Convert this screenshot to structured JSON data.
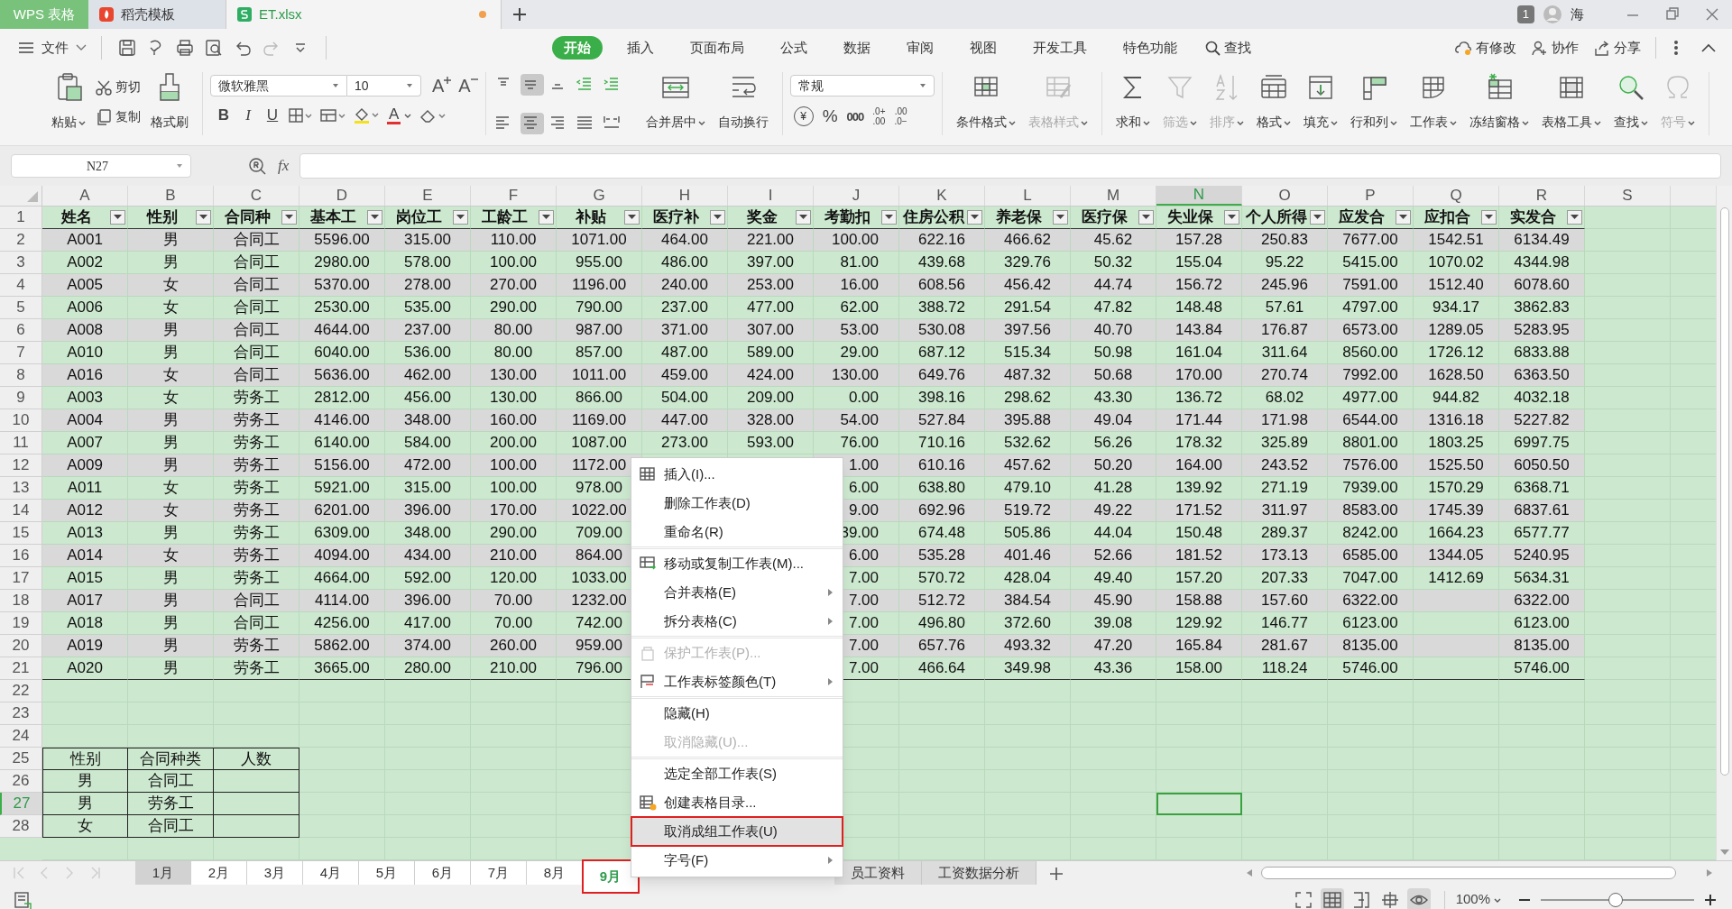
{
  "title_tabs": [
    {
      "label": "WPS 表格",
      "kind": "app",
      "selected": false,
      "unsaved": false
    },
    {
      "label": "稻壳模板",
      "kind": "template",
      "selected": false,
      "unsaved": false
    },
    {
      "label": "ET.xlsx",
      "kind": "file",
      "selected": true,
      "unsaved": true
    }
  ],
  "window": {
    "badge": "1",
    "user": "海"
  },
  "menu": {
    "file": "文件",
    "tabs": [
      {
        "label": "开始",
        "selected": true
      },
      {
        "label": "插入",
        "selected": false
      },
      {
        "label": "页面布局",
        "selected": false
      },
      {
        "label": "公式",
        "selected": false
      },
      {
        "label": "数据",
        "selected": false
      },
      {
        "label": "审阅",
        "selected": false
      },
      {
        "label": "视图",
        "selected": false
      },
      {
        "label": "开发工具",
        "selected": false
      },
      {
        "label": "特色功能",
        "selected": false
      }
    ],
    "search": "查找",
    "actions": [
      "有修改",
      "协作",
      "分享"
    ]
  },
  "ribbon": {
    "paste": "粘贴",
    "cut": "剪切",
    "copy": "复制",
    "format_painter": "格式刷",
    "font_name": "微软雅黑",
    "font_size": "10",
    "font_buttons": [
      "B",
      "I",
      "U"
    ],
    "font_grow": "A",
    "font_shrink": "A",
    "font_color": "A",
    "merge": "合并居中",
    "wrap": "自动换行",
    "number_format": "常规",
    "number_buttons": [
      "¥",
      "%",
      "000"
    ],
    "decimal_buttons": [
      {
        "top": ".0+",
        "bottom": ".00"
      },
      {
        "top": ".00",
        "bottom": ".0−"
      }
    ],
    "tools": [
      {
        "label": "条件格式",
        "disabled": false
      },
      {
        "label": "表格样式",
        "disabled": true
      },
      {
        "label": "求和",
        "disabled": false
      },
      {
        "label": "筛选",
        "disabled": true
      },
      {
        "label": "排序",
        "disabled": true
      },
      {
        "label": "格式",
        "disabled": false
      },
      {
        "label": "填充",
        "disabled": false
      },
      {
        "label": "行和列",
        "disabled": false
      },
      {
        "label": "工作表",
        "disabled": false
      },
      {
        "label": "冻结窗格",
        "disabled": false
      },
      {
        "label": "表格工具",
        "disabled": false
      },
      {
        "label": "查找",
        "disabled": false
      },
      {
        "label": "符号",
        "disabled": true
      }
    ]
  },
  "formula_bar": {
    "name_box": "N27",
    "fx": "fx"
  },
  "sheet": {
    "columns": [
      {
        "letter": "A",
        "selected": false
      },
      {
        "letter": "B",
        "selected": false
      },
      {
        "letter": "C",
        "selected": false
      },
      {
        "letter": "D",
        "selected": false
      },
      {
        "letter": "E",
        "selected": false
      },
      {
        "letter": "F",
        "selected": false
      },
      {
        "letter": "G",
        "selected": false
      },
      {
        "letter": "H",
        "selected": false
      },
      {
        "letter": "I",
        "selected": false
      },
      {
        "letter": "J",
        "selected": false
      },
      {
        "letter": "K",
        "selected": false
      },
      {
        "letter": "L",
        "selected": false
      },
      {
        "letter": "M",
        "selected": false
      },
      {
        "letter": "N",
        "selected": true
      },
      {
        "letter": "O",
        "selected": false
      },
      {
        "letter": "P",
        "selected": false
      },
      {
        "letter": "Q",
        "selected": false
      },
      {
        "letter": "R",
        "selected": false
      },
      {
        "letter": "S",
        "selected": false
      }
    ],
    "row_headers": [
      {
        "label": "1",
        "selected": false
      },
      {
        "label": "2",
        "selected": false
      },
      {
        "label": "3",
        "selected": false
      },
      {
        "label": "4",
        "selected": false
      },
      {
        "label": "5",
        "selected": false
      },
      {
        "label": "6",
        "selected": false
      },
      {
        "label": "7",
        "selected": false
      },
      {
        "label": "8",
        "selected": false
      },
      {
        "label": "9",
        "selected": false
      },
      {
        "label": "10",
        "selected": false
      },
      {
        "label": "11",
        "selected": false
      },
      {
        "label": "12",
        "selected": false
      },
      {
        "label": "13",
        "selected": false
      },
      {
        "label": "14",
        "selected": false
      },
      {
        "label": "15",
        "selected": false
      },
      {
        "label": "16",
        "selected": false
      },
      {
        "label": "17",
        "selected": false
      },
      {
        "label": "18",
        "selected": false
      },
      {
        "label": "19",
        "selected": false
      },
      {
        "label": "20",
        "selected": false
      },
      {
        "label": "21",
        "selected": false
      },
      {
        "label": "22",
        "selected": false
      },
      {
        "label": "23",
        "selected": false
      },
      {
        "label": "24",
        "selected": false
      },
      {
        "label": "25",
        "selected": false
      },
      {
        "label": "26",
        "selected": false
      },
      {
        "label": "27",
        "selected": true
      },
      {
        "label": "28",
        "selected": false
      }
    ],
    "table": {
      "columns": [
        "姓名",
        "性别",
        "合同种",
        "基本工",
        "岗位工",
        "工龄工",
        "补贴",
        "医疗补",
        "奖金",
        "考勤扣",
        "住房公积",
        "养老保",
        "医疗保",
        "失业保",
        "个人所得",
        "应发合",
        "应扣合",
        "实发合"
      ],
      "rows": [
        [
          "A001",
          "男",
          "合同工",
          "5596.00",
          "315.00",
          "110.00",
          "1071.00",
          "464.00",
          "221.00",
          "100.00",
          "622.16",
          "466.62",
          "45.62",
          "157.28",
          "250.83",
          "7677.00",
          "1542.51",
          "6134.49"
        ],
        [
          "A002",
          "男",
          "合同工",
          "2980.00",
          "578.00",
          "100.00",
          "955.00",
          "486.00",
          "397.00",
          "81.00",
          "439.68",
          "329.76",
          "50.32",
          "155.04",
          "95.22",
          "5415.00",
          "1070.02",
          "4344.98"
        ],
        [
          "A005",
          "女",
          "合同工",
          "5370.00",
          "278.00",
          "270.00",
          "1196.00",
          "240.00",
          "253.00",
          "16.00",
          "608.56",
          "456.42",
          "44.74",
          "156.72",
          "245.96",
          "7591.00",
          "1512.40",
          "6078.60"
        ],
        [
          "A006",
          "女",
          "合同工",
          "2530.00",
          "535.00",
          "290.00",
          "790.00",
          "237.00",
          "477.00",
          "62.00",
          "388.72",
          "291.54",
          "47.82",
          "148.48",
          "57.61",
          "4797.00",
          "934.17",
          "3862.83"
        ],
        [
          "A008",
          "男",
          "合同工",
          "4644.00",
          "237.00",
          "80.00",
          "987.00",
          "371.00",
          "307.00",
          "53.00",
          "530.08",
          "397.56",
          "40.70",
          "143.84",
          "176.87",
          "6573.00",
          "1289.05",
          "5283.95"
        ],
        [
          "A010",
          "男",
          "合同工",
          "6040.00",
          "536.00",
          "80.00",
          "857.00",
          "487.00",
          "589.00",
          "29.00",
          "687.12",
          "515.34",
          "50.98",
          "161.04",
          "311.64",
          "8560.00",
          "1726.12",
          "6833.88"
        ],
        [
          "A016",
          "女",
          "合同工",
          "5636.00",
          "462.00",
          "130.00",
          "1011.00",
          "459.00",
          "424.00",
          "130.00",
          "649.76",
          "487.32",
          "50.68",
          "170.00",
          "270.74",
          "7992.00",
          "1628.50",
          "6363.50"
        ],
        [
          "A003",
          "女",
          "劳务工",
          "2812.00",
          "456.00",
          "130.00",
          "866.00",
          "504.00",
          "209.00",
          "0.00",
          "398.16",
          "298.62",
          "43.30",
          "136.72",
          "68.02",
          "4977.00",
          "944.82",
          "4032.18"
        ],
        [
          "A004",
          "男",
          "劳务工",
          "4146.00",
          "348.00",
          "160.00",
          "1169.00",
          "447.00",
          "328.00",
          "54.00",
          "527.84",
          "395.88",
          "49.04",
          "171.44",
          "171.98",
          "6544.00",
          "1316.18",
          "5227.82"
        ],
        [
          "A007",
          "男",
          "劳务工",
          "6140.00",
          "584.00",
          "200.00",
          "1087.00",
          "273.00",
          "593.00",
          "76.00",
          "710.16",
          "532.62",
          "56.26",
          "178.32",
          "325.89",
          "8801.00",
          "1803.25",
          "6997.75"
        ],
        [
          "A009",
          "男",
          "劳务工",
          "5156.00",
          "472.00",
          "100.00",
          "1172.00",
          null,
          null,
          "1.00",
          "610.16",
          "457.62",
          "50.20",
          "164.00",
          "243.52",
          "7576.00",
          "1525.50",
          "6050.50"
        ],
        [
          "A011",
          "女",
          "劳务工",
          "5921.00",
          "315.00",
          "100.00",
          "978.00",
          null,
          null,
          "6.00",
          "638.80",
          "479.10",
          "41.28",
          "139.92",
          "271.19",
          "7939.00",
          "1570.29",
          "6368.71"
        ],
        [
          "A012",
          "女",
          "劳务工",
          "6201.00",
          "396.00",
          "170.00",
          "1022.00",
          null,
          null,
          "9.00",
          "692.96",
          "519.72",
          "49.22",
          "171.52",
          "311.97",
          "8583.00",
          "1745.39",
          "6837.61"
        ],
        [
          "A013",
          "男",
          "劳务工",
          "6309.00",
          "348.00",
          "290.00",
          "709.00",
          null,
          null,
          "39.00",
          "674.48",
          "505.86",
          "44.04",
          "150.48",
          "289.37",
          "8242.00",
          "1664.23",
          "6577.77"
        ],
        [
          "A014",
          "女",
          "劳务工",
          "4094.00",
          "434.00",
          "210.00",
          "864.00",
          null,
          null,
          "6.00",
          "535.28",
          "401.46",
          "52.66",
          "181.52",
          "173.13",
          "6585.00",
          "1344.05",
          "5240.95"
        ],
        [
          "A015",
          "男",
          "劳务工",
          "4664.00",
          "592.00",
          "120.00",
          "1033.00",
          null,
          null,
          "7.00",
          "570.72",
          "428.04",
          "49.40",
          "157.20",
          "207.33",
          "7047.00",
          "1412.69",
          "5634.31"
        ],
        [
          "A017",
          "男",
          "合同工",
          "4114.00",
          "396.00",
          "70.00",
          "1232.00",
          null,
          null,
          "7.00",
          "512.72",
          "384.54",
          "45.90",
          "158.88",
          "157.60",
          "6322.00",
          null,
          "6322.00"
        ],
        [
          "A018",
          "男",
          "合同工",
          "4256.00",
          "417.00",
          "70.00",
          "742.00",
          null,
          null,
          "7.00",
          "496.80",
          "372.60",
          "39.08",
          "129.92",
          "146.77",
          "6123.00",
          null,
          "6123.00"
        ],
        [
          "A019",
          "男",
          "劳务工",
          "5862.00",
          "374.00",
          "260.00",
          "959.00",
          null,
          null,
          "7.00",
          "657.76",
          "493.32",
          "47.20",
          "165.84",
          "281.67",
          "8135.00",
          null,
          "8135.00"
        ],
        [
          "A020",
          "男",
          "劳务工",
          "3665.00",
          "280.00",
          "210.00",
          "796.00",
          null,
          null,
          "7.00",
          "466.64",
          "349.98",
          "43.36",
          "158.00",
          "118.24",
          "5746.00",
          null,
          "5746.00"
        ]
      ]
    },
    "summary": {
      "columns": [
        "性别",
        "合同种类",
        "人数"
      ],
      "rows": [
        [
          "男",
          "合同工"
        ],
        [
          "男",
          "劳务工"
        ],
        [
          "女",
          "合同工"
        ]
      ]
    }
  },
  "sheet_tabs": [
    {
      "label": "1月",
      "grouped": true,
      "selected": false,
      "highlighted": false
    },
    {
      "label": "2月",
      "grouped": false,
      "selected": false,
      "highlighted": false
    },
    {
      "label": "3月",
      "grouped": false,
      "selected": false,
      "highlighted": false
    },
    {
      "label": "4月",
      "grouped": false,
      "selected": false,
      "highlighted": false
    },
    {
      "label": "5月",
      "grouped": false,
      "selected": false,
      "highlighted": false
    },
    {
      "label": "6月",
      "grouped": false,
      "selected": false,
      "highlighted": false
    },
    {
      "label": "7月",
      "grouped": false,
      "selected": false,
      "highlighted": false
    },
    {
      "label": "8月",
      "grouped": false,
      "selected": false,
      "highlighted": false
    },
    {
      "label": "9月",
      "grouped": false,
      "selected": true,
      "highlighted": true
    }
  ],
  "other_sheet_tabs": [
    "员工资料",
    "工资数据分析"
  ],
  "context_menu": [
    {
      "label": "插入(I)...",
      "disabled": false,
      "submenu": false,
      "highlighted": false,
      "separator_before": false
    },
    {
      "label": "删除工作表(D)",
      "disabled": false,
      "submenu": false,
      "highlighted": false,
      "separator_before": false
    },
    {
      "label": "重命名(R)",
      "disabled": false,
      "submenu": false,
      "highlighted": false,
      "separator_before": false
    },
    {
      "label": "移动或复制工作表(M)...",
      "disabled": false,
      "submenu": false,
      "highlighted": false,
      "separator_before": true
    },
    {
      "label": "合并表格(E)",
      "disabled": false,
      "submenu": true,
      "highlighted": false,
      "separator_before": false
    },
    {
      "label": "拆分表格(C)",
      "disabled": false,
      "submenu": true,
      "highlighted": false,
      "separator_before": false
    },
    {
      "label": "保护工作表(P)...",
      "disabled": true,
      "submenu": false,
      "highlighted": false,
      "separator_before": true
    },
    {
      "label": "工作表标签颜色(T)",
      "disabled": false,
      "submenu": true,
      "highlighted": false,
      "separator_before": false
    },
    {
      "label": "隐藏(H)",
      "disabled": false,
      "submenu": false,
      "highlighted": false,
      "separator_before": true
    },
    {
      "label": "取消隐藏(U)...",
      "disabled": true,
      "submenu": false,
      "highlighted": false,
      "separator_before": false
    },
    {
      "label": "选定全部工作表(S)",
      "disabled": false,
      "submenu": false,
      "highlighted": false,
      "separator_before": true
    },
    {
      "label": "创建表格目录...",
      "disabled": false,
      "submenu": false,
      "highlighted": false,
      "separator_before": false
    },
    {
      "label": "取消成组工作表(U)",
      "disabled": false,
      "submenu": false,
      "highlighted": true,
      "separator_before": false
    },
    {
      "label": "字号(F)",
      "disabled": false,
      "submenu": true,
      "highlighted": false,
      "separator_before": false
    }
  ],
  "status_bar": {
    "zoom": "100%",
    "zoom_level": {
      "level": 0.49
    }
  }
}
